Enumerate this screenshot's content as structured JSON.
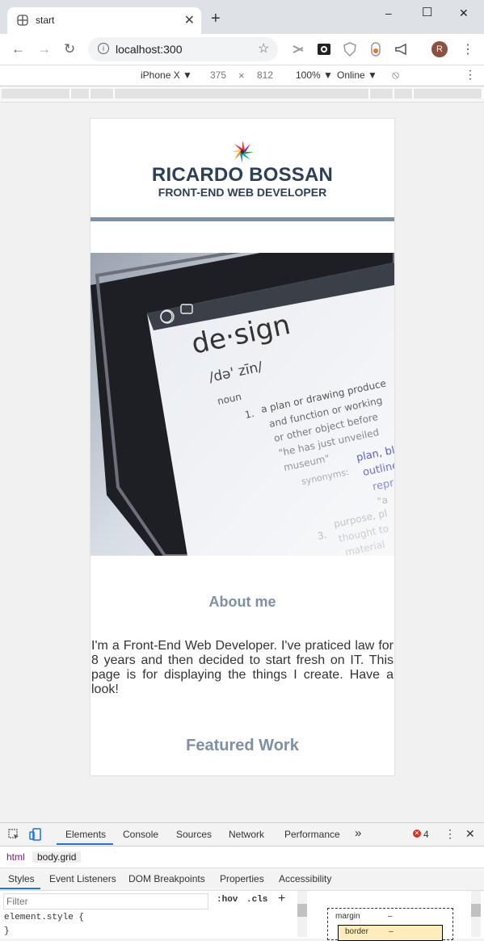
{
  "browser": {
    "tab_title": "start",
    "tab_close": "✕",
    "new_tab": "+",
    "window_controls": {
      "minimize": "–",
      "maximize": "☐",
      "close": "✕"
    },
    "nav": {
      "back": "←",
      "forward": "→",
      "reload": "↻"
    },
    "url": "localhost:300",
    "url_info_icon": "i",
    "bookmark_star": "☆",
    "extensions": [
      "scissors-icon",
      "camera-icon",
      "shield-icon",
      "fire-icon",
      "megaphone-icon"
    ],
    "avatar_letter": "R",
    "menu": "⋮"
  },
  "device_toolbar": {
    "device": "iPhone X ▼",
    "width": "375",
    "times": "×",
    "height": "812",
    "zoom": "100% ▼",
    "network": "Online ▼",
    "rotate": "⦸",
    "menu": "⋮"
  },
  "site": {
    "name": "RICARDO BOSSAN",
    "role": "FRONT-END WEB DEVELOPER",
    "about_heading": "About me",
    "bio": "I'm a Front-End Web Developer. I've praticed law for 8 years and then decided to start fresh on IT. This page is for displaying the things I create. Have a look!",
    "featured_heading": "Featured Work",
    "hero_image_alt": "design dictionary entry on phone",
    "hero_text": {
      "word": "de·sign",
      "pron": "/də' zīn/",
      "pos": "noun",
      "num": "1.",
      "def1": "a plan or drawing produce",
      "def2": "and function or working",
      "def3": "or other object before",
      "quote": "\"he has just unveiled",
      "quote2": "museum\"",
      "syn": "synonyms:",
      "syn1": "plan, bl",
      "syn2": "outline",
      "syn3": "repr",
      "syn4": "\"a",
      "num2": "3.",
      "def4": "purpose, pl",
      "def5": "thought to",
      "def6": "material"
    }
  },
  "devtools": {
    "tabs": [
      "Elements",
      "Console",
      "Sources",
      "Network",
      "Performance"
    ],
    "more": "»",
    "error_count": "4",
    "menu": "⋮",
    "close": "✕",
    "breadcrumbs": [
      "html",
      "body.grid"
    ],
    "subtabs": [
      "Styles",
      "Event Listeners",
      "DOM Breakpoints",
      "Properties",
      "Accessibility"
    ],
    "filter_placeholder": "Filter",
    "hov": ":hov",
    "cls": ".cls",
    "add": "+",
    "code_line1": "element.style {",
    "code_line2": "}",
    "box_margin": "margin",
    "box_margin_val": "–",
    "box_border": "border",
    "box_border_val": "–"
  }
}
